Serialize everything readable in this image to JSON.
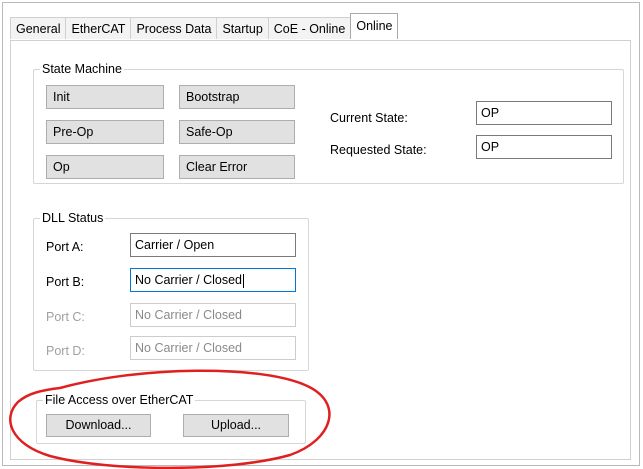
{
  "tabs": [
    {
      "label": "General"
    },
    {
      "label": "EtherCAT"
    },
    {
      "label": "Process Data"
    },
    {
      "label": "Startup"
    },
    {
      "label": "CoE - Online"
    },
    {
      "label": "Online",
      "active": true
    }
  ],
  "state_machine": {
    "legend": "State Machine",
    "buttons": {
      "init": "Init",
      "bootstrap": "Bootstrap",
      "pre_op": "Pre-Op",
      "safe_op": "Safe-Op",
      "op": "Op",
      "clear_error": "Clear Error"
    },
    "current_state_label": "Current State:",
    "current_state_value": "OP",
    "requested_state_label": "Requested State:",
    "requested_state_value": "OP"
  },
  "dll_status": {
    "legend": "DLL Status",
    "ports": [
      {
        "label": "Port A:",
        "value": "Carrier / Open"
      },
      {
        "label": "Port B:",
        "value": "No Carrier / Closed"
      },
      {
        "label": "Port C:",
        "value": "No Carrier / Closed"
      },
      {
        "label": "Port D:",
        "value": "No Carrier / Closed"
      }
    ]
  },
  "file_access": {
    "legend": "File Access over EtherCAT",
    "download_label": "Download...",
    "upload_label": "Upload..."
  },
  "colors": {
    "annotation_ellipse": "#e02020",
    "focus_border": "#0078d7",
    "button_face": "#e1e1e1"
  }
}
